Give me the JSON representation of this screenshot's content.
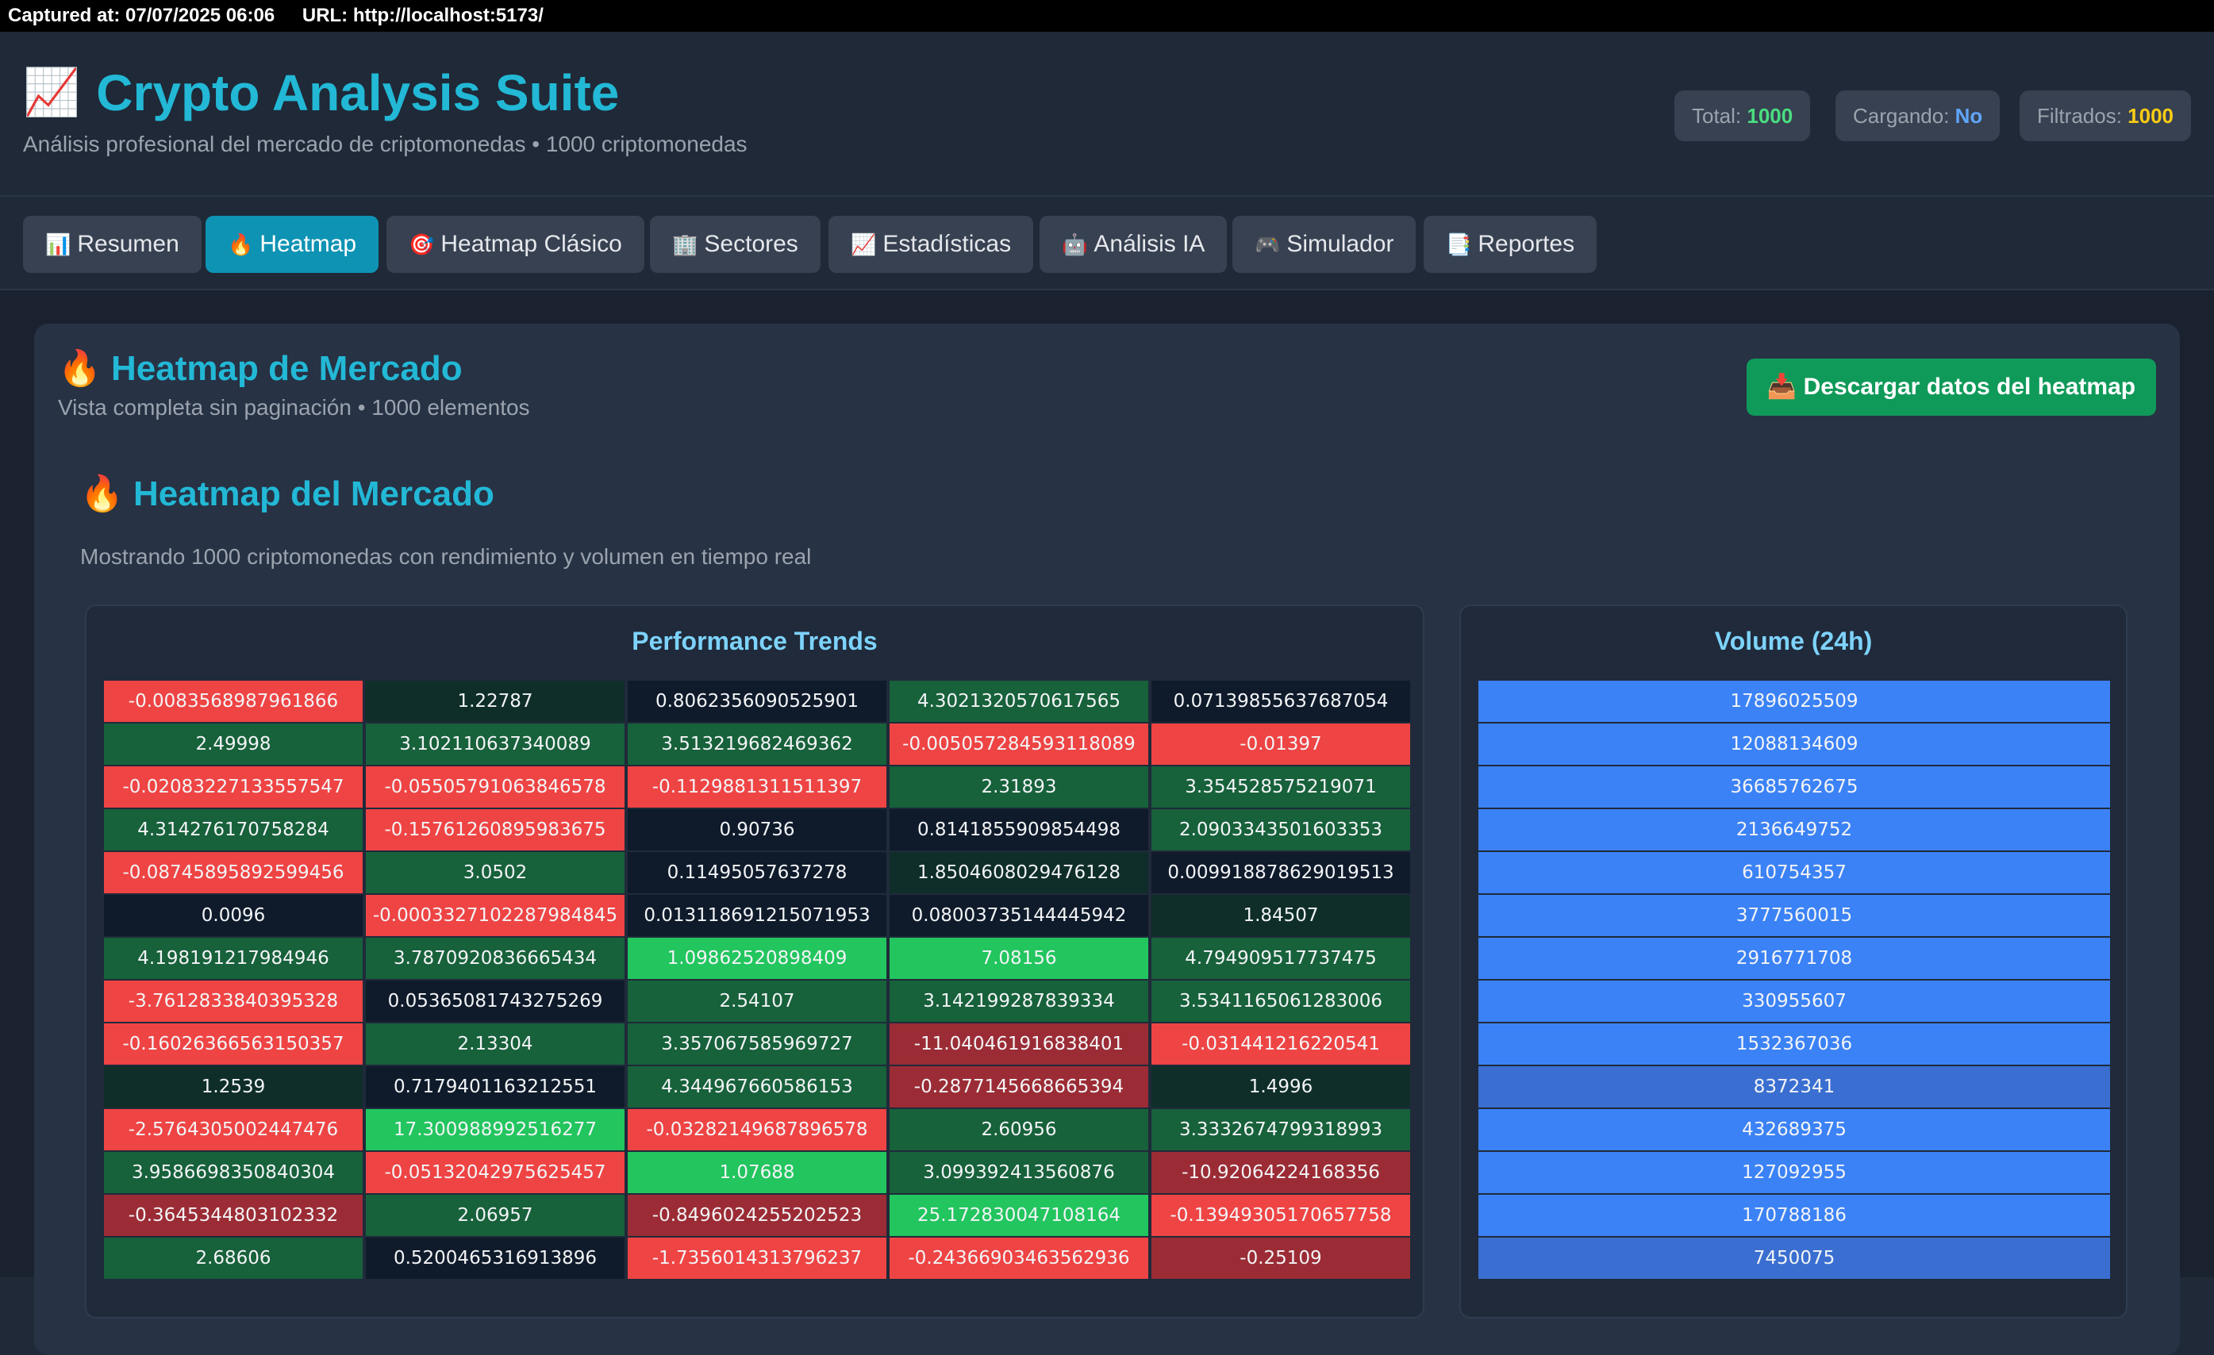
{
  "capture": {
    "captured_at": "Captured at: 07/07/2025 06:06",
    "url": "URL: http://localhost:5173/"
  },
  "header": {
    "title": "Crypto Analysis Suite",
    "subtitle": "Análisis profesional del mercado de criptomonedas • 1000 criptomonedas",
    "stats": {
      "total_label": "Total:",
      "total_value": "1000",
      "loading_label": "Cargando:",
      "loading_value": "No",
      "filtered_label": "Filtrados:",
      "filtered_value": "1000"
    }
  },
  "nav": {
    "tabs": [
      {
        "icon": "📊",
        "label": "Resumen"
      },
      {
        "icon": "🔥",
        "label": "Heatmap"
      },
      {
        "icon": "🎯",
        "label": "Heatmap Clásico"
      },
      {
        "icon": "🏢",
        "label": "Sectores"
      },
      {
        "icon": "📈",
        "label": "Estadísticas"
      },
      {
        "icon": "🤖",
        "label": "Análisis IA"
      },
      {
        "icon": "🎮",
        "label": "Simulador"
      },
      {
        "icon": "📑",
        "label": "Reportes"
      }
    ],
    "active_tab": "Heatmap"
  },
  "panel": {
    "title": "Heatmap de Mercado",
    "subtitle": "Vista completa sin paginación • 1000 elementos",
    "download_button": "📥 Descargar datos del heatmap"
  },
  "heatmap": {
    "title": "Heatmap del Mercado",
    "description": "Mostrando 1000 criptomonedas con rendimiento y volumen en tiempo real",
    "performance_title": "Performance Trends",
    "volume_title": "Volume (24h)",
    "colors": {
      "neg_strong": "#ef4444",
      "neg_medium": "#9b2c35",
      "pos_bright": "#22c55e",
      "pos_medium": "#17613b",
      "pos_dark": "#0f2e2a",
      "neutral": "#0f1b2b",
      "volume_high": "#3b82f6",
      "volume_low": "#3a6fd1"
    },
    "performance": [
      [
        "-0.0083568987961866",
        "1.22787",
        "0.8062356090525901",
        "4.3021320570617565",
        "0.07139855637687054"
      ],
      [
        "2.49998",
        "3.102110637340089",
        "3.513219682469362",
        "-0.005057284593118089",
        "-0.01397"
      ],
      [
        "-0.020832271335575 47",
        "-0.05505791063846578",
        "-0.1129881311511397",
        "2.31893",
        "3.354528575219071"
      ],
      [
        "4.314276170758284",
        "-0.15761260895983675",
        "0.90736",
        "0.8141855909854498",
        "2.0903343501603353"
      ],
      [
        "-0.08745895892599456",
        "3.0502",
        "0.11495057637278",
        "1.8504608029476128",
        "0.009918878629019513"
      ],
      [
        "0.0096",
        "-0.0003327102287984845",
        "0.013118691215071953",
        "0.08003735144445942",
        "1.84507"
      ],
      [
        "4.198191217984946",
        "3.7870920836665434",
        "1.09862520898409",
        "7.08156",
        "4.794909517737475"
      ],
      [
        "-3.7612833840395328",
        "0.05365081743275269",
        "2.54107",
        "3.142199287839334",
        "3.5341165061283006"
      ],
      [
        "-0.16026366563150357",
        "2.13304",
        "3.357067585969727",
        "-11.040461916838401",
        "-0.031441216220541"
      ],
      [
        "1.2539",
        "0.7179401163212551",
        "4.344967660586153",
        "-0.2877145668665394",
        "1.4996"
      ],
      [
        "-2.5764305002447476",
        "17.300988992516277",
        "-0.03282149687896578",
        "2.60956",
        "3.3332674799318993"
      ],
      [
        "3.9586698350840304",
        "-0.05132042975625457",
        "1.07688",
        "3.099392413560876",
        "-10.92064224168356"
      ],
      [
        "-0.3645344803102332",
        "2.06957",
        "-0.8496024255202523",
        "25.172830047108164",
        "-0.13949305170657758"
      ],
      [
        "2.68606",
        "0.5200465316913896",
        "-1.7356014313796237",
        "-0.24366903463562936",
        "-0.25109"
      ]
    ],
    "volume": [
      "17896025509",
      "12088134609",
      "36685762675",
      "2136649752",
      "610754357",
      "3777560015",
      "2916771708",
      "330955607",
      "1532367036",
      "8372341",
      "432689375",
      "127092955",
      "170788186",
      "7450075"
    ]
  }
}
